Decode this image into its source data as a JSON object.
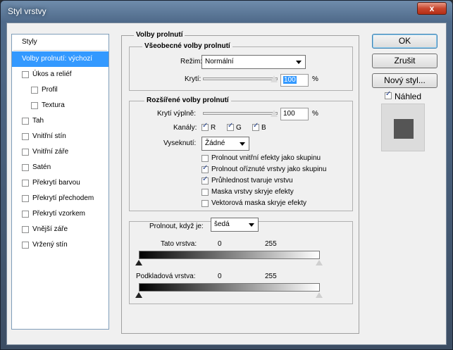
{
  "window": {
    "title": "Styl vrstvy",
    "close_glyph": "x"
  },
  "left_panel": {
    "header": "Styly",
    "items": [
      {
        "label": "Volby prolnutí: výchozí",
        "selected": true,
        "checkbox": false
      },
      {
        "label": "Úkos a reliéf",
        "checked": false
      },
      {
        "label": "Profil",
        "checked": false,
        "sub": true
      },
      {
        "label": "Textura",
        "checked": false,
        "sub": true
      },
      {
        "label": "Tah",
        "checked": false
      },
      {
        "label": "Vnitřní stín",
        "checked": false
      },
      {
        "label": "Vnitřní záře",
        "checked": false
      },
      {
        "label": "Satén",
        "checked": false
      },
      {
        "label": "Překrytí barvou",
        "checked": false
      },
      {
        "label": "Překrytí přechodem",
        "checked": false
      },
      {
        "label": "Překrytí vzorkem",
        "checked": false
      },
      {
        "label": "Vnější záře",
        "checked": false
      },
      {
        "label": "Vržený stín",
        "checked": false
      }
    ]
  },
  "blending": {
    "title": "Volby prolnutí",
    "general": {
      "title": "Všeobecné volby prolnutí",
      "mode_label": "Režim:",
      "mode_value": "Normální",
      "opacity_label": "Krytí:",
      "opacity_value": "100",
      "opacity_unit": "%",
      "opacity_level": 1.0
    },
    "advanced": {
      "title": "Rozšířené volby prolnutí",
      "fill_label": "Krytí výplně:",
      "fill_value": "100",
      "fill_unit": "%",
      "fill_level": 1.0,
      "channels_label": "Kanály:",
      "channels": [
        {
          "label": "R",
          "checked": true
        },
        {
          "label": "G",
          "checked": true
        },
        {
          "label": "B",
          "checked": true
        }
      ],
      "knockout_label": "Vyseknutí:",
      "knockout_value": "Žádné",
      "options": [
        {
          "label": "Prolnout vnitřní efekty jako skupinu",
          "checked": false
        },
        {
          "label": "Prolnout oříznuté vrstvy jako skupinu",
          "checked": true
        },
        {
          "label": "Průhlednost tvaruje vrstvu",
          "checked": true
        },
        {
          "label": "Maska vrstvy skryje efekty",
          "checked": false
        },
        {
          "label": "Vektorová maska skryje efekty",
          "checked": false
        }
      ]
    },
    "blend_if": {
      "label": "Prolnout, když je:",
      "value": "šedá",
      "this_layer_label": "Tato vrstva:",
      "underlying_label": "Podkladová vrstva:",
      "min": "0",
      "max": "255"
    }
  },
  "buttons": {
    "ok": "OK",
    "cancel": "Zrušit",
    "new_style": "Nový styl...",
    "preview_label": "Náhled",
    "preview_checked": true
  },
  "colors": {
    "selection": "#3399ff",
    "preview_swatch": "#555555"
  }
}
